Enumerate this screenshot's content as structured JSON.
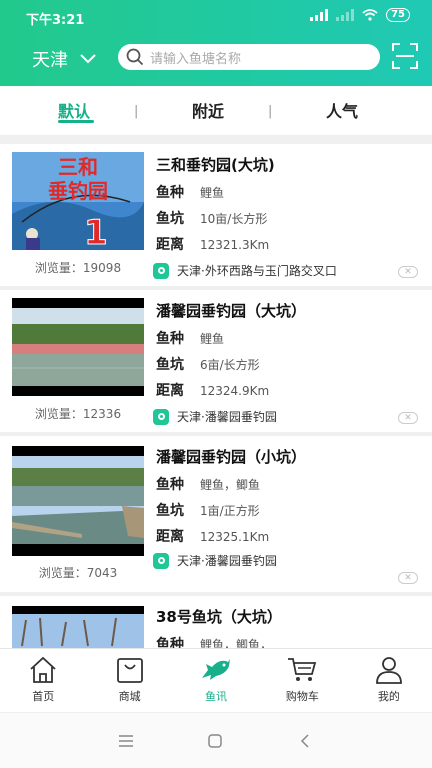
{
  "status": {
    "time": "下午3:21",
    "battery": "75"
  },
  "header": {
    "city": "天津",
    "search_placeholder": "请输入鱼塘名称"
  },
  "sort_tabs": [
    {
      "label": "默认",
      "active": true
    },
    {
      "label": "附近",
      "active": false
    },
    {
      "label": "人气",
      "active": false
    }
  ],
  "labels": {
    "fish": "鱼种",
    "pond": "鱼坑",
    "distance": "距离"
  },
  "spots": [
    {
      "title": "三和垂钓园(大坑)",
      "fish": "鲤鱼",
      "pond": "10亩/长方形",
      "distance": "12321.3Km",
      "views": "浏览量：19098",
      "location": "天津·外环西路与玉门路交叉口",
      "sign_text_1": "三和",
      "sign_text_2": "垂钓园",
      "sign_number": "1"
    },
    {
      "title": "潘馨园垂钓园（大坑）",
      "fish": "鲤鱼",
      "pond": "6亩/长方形",
      "distance": "12324.9Km",
      "views": "浏览量：12336",
      "location": "天津·潘馨园垂钓园"
    },
    {
      "title": "潘馨园垂钓园（小坑）",
      "fish": "鲤鱼，鲫鱼",
      "pond": "1亩/正方形",
      "distance": "12325.1Km",
      "views": "浏览量：7043",
      "location": "天津·潘馨园垂钓园"
    },
    {
      "title": "38号鱼坑（大坑）",
      "fish": "鲤鱼，鲫鱼，",
      "pond": "",
      "distance": "",
      "views": "",
      "location": ""
    }
  ],
  "tabbar": [
    {
      "label": "首页",
      "icon": "home-icon"
    },
    {
      "label": "商城",
      "icon": "shopping-bag-icon"
    },
    {
      "label": "鱼讯",
      "icon": "fish-icon",
      "active": true
    },
    {
      "label": "购物车",
      "icon": "cart-icon"
    },
    {
      "label": "我的",
      "icon": "user-icon"
    }
  ],
  "colors": {
    "accent": "#17b08a",
    "header_start": "#22c98c",
    "header_end": "#20c9b4"
  }
}
